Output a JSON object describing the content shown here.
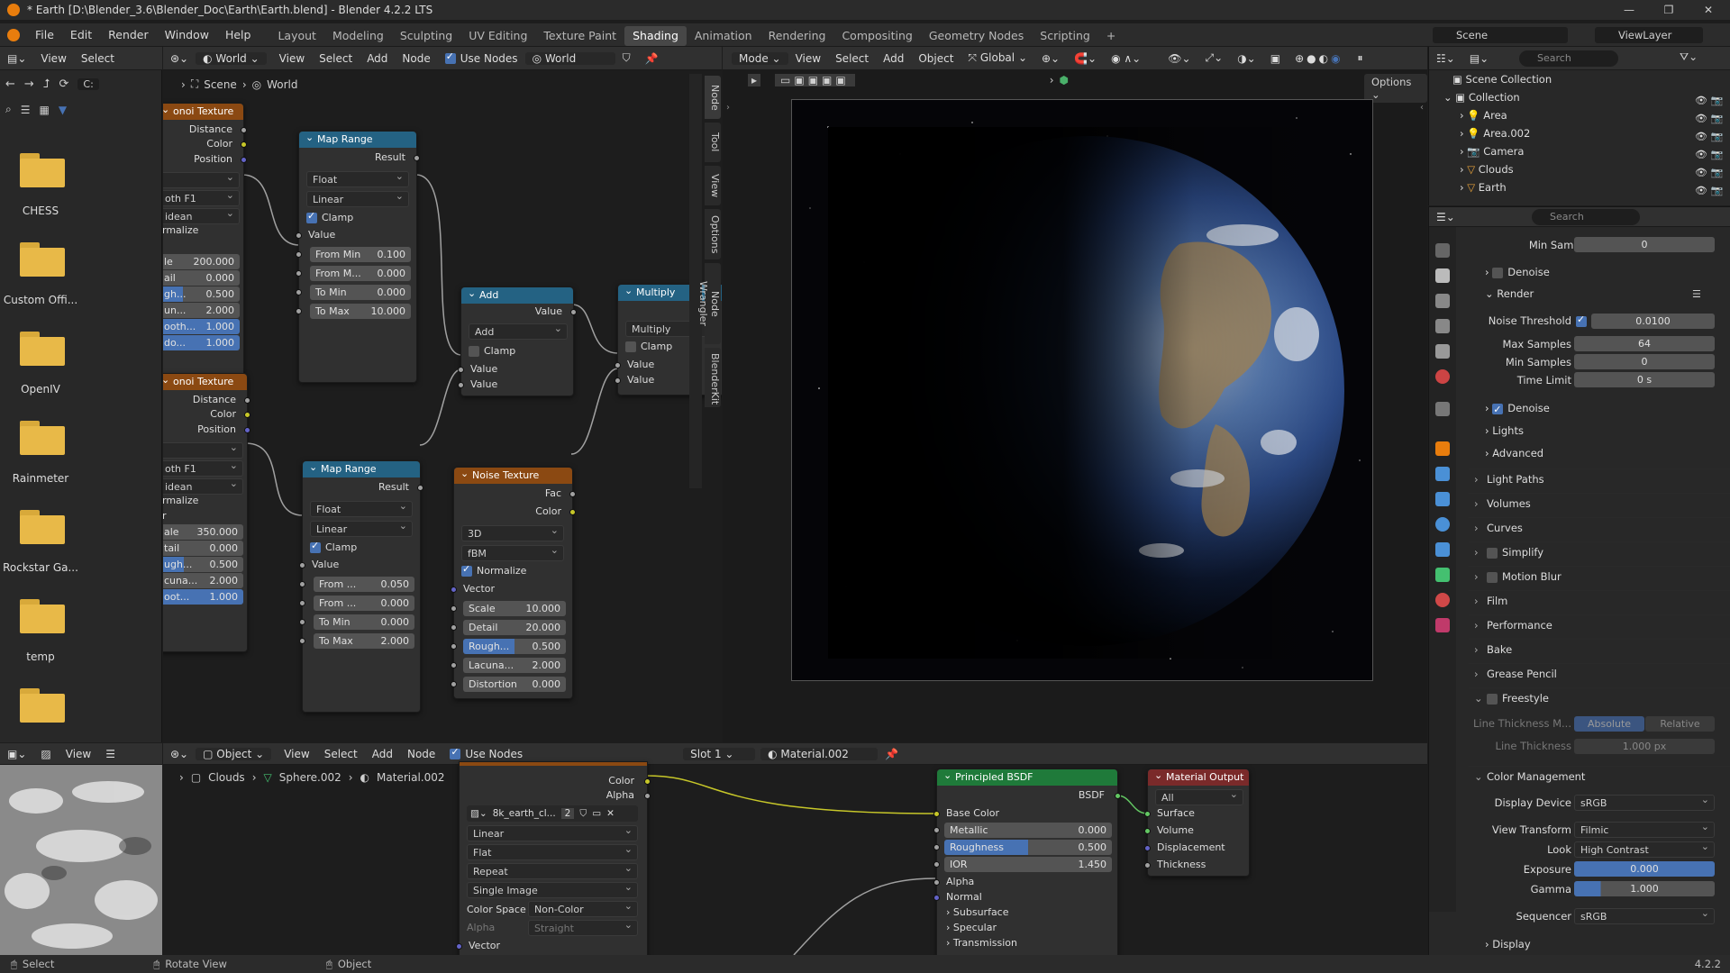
{
  "window": {
    "title": "* Earth [D:\\Blender_3.6\\Blender_Doc\\Earth\\Earth.blend] - Blender 4.2.2 LTS"
  },
  "menus": [
    "File",
    "Edit",
    "Render",
    "Window",
    "Help"
  ],
  "workspaces": [
    "Layout",
    "Modeling",
    "Sculpting",
    "UV Editing",
    "Texture Paint",
    "Shading",
    "Animation",
    "Rendering",
    "Compositing",
    "Geometry Nodes",
    "Scripting"
  ],
  "active_workspace": "Shading",
  "scene": {
    "name": "Scene",
    "view_layer": "ViewLayer"
  },
  "file_browser": {
    "path_text": "C:",
    "folders": [
      "CHESS",
      "Custom Offi...",
      "OpenIV",
      "Rainmeter",
      "Rockstar Ga...",
      "temp",
      ""
    ]
  },
  "node_editor_top": {
    "header": {
      "type": "World",
      "view": "View",
      "select": "Select",
      "add": "Add",
      "node": "Node",
      "use_nodes": "Use Nodes",
      "world_name": "World"
    },
    "breadcrumb": [
      "Scene",
      "World"
    ],
    "side_tabs": [
      "Node",
      "Tool",
      "View",
      "Options",
      "Node Wrangler",
      "BlenderKit"
    ],
    "nodes": {
      "voronoi1": {
        "title": "onoi Texture",
        "outputs": [
          "Distance",
          "Color",
          "Position"
        ],
        "dd1": "",
        "dd2": "oth F1",
        "dd3": "idean",
        "normalize": "rmalize",
        "fields": [
          [
            "le",
            "200.000"
          ],
          [
            "ail",
            "0.000"
          ],
          [
            "gh...",
            "0.500"
          ],
          [
            "un...",
            "2.000"
          ],
          [
            "ooth...",
            "1.000"
          ],
          [
            "do...",
            "1.000"
          ]
        ]
      },
      "voronoi2": {
        "title": "onoi Texture",
        "outputs": [
          "Distance",
          "Color",
          "Position"
        ],
        "dd1": "",
        "dd2": "oth F1",
        "dd3": "idean",
        "normalize": "rmalize",
        "r": "r",
        "fields": [
          [
            "ale",
            "350.000"
          ],
          [
            "tail",
            "0.000"
          ],
          [
            "ugh...",
            "0.500"
          ],
          [
            "cuna...",
            "2.000"
          ],
          [
            "oot...",
            "1.000"
          ]
        ]
      },
      "maprange1": {
        "title": "Map Range",
        "result": "Result",
        "dtype": "Float",
        "interp": "Linear",
        "clamp": "Clamp",
        "value": "Value",
        "fields": [
          [
            "From Min",
            "0.100"
          ],
          [
            "From M...",
            "0.000"
          ],
          [
            "To Min",
            "0.000"
          ],
          [
            "To Max",
            "10.000"
          ]
        ]
      },
      "maprange2": {
        "title": "Map Range",
        "result": "Result",
        "dtype": "Float",
        "interp": "Linear",
        "clamp": "Clamp",
        "value": "Value",
        "fields": [
          [
            "From ...",
            "0.050"
          ],
          [
            "From ...",
            "0.000"
          ],
          [
            "To Min",
            "0.000"
          ],
          [
            "To Max",
            "2.000"
          ]
        ]
      },
      "add": {
        "title": "Add",
        "value": "Value",
        "op": "Add",
        "clamp": "Clamp",
        "in1": "Value",
        "in2": "Value"
      },
      "multiply": {
        "title": "Multiply",
        "value": "Value",
        "op": "Multiply",
        "clamp": "Clamp",
        "in1": "Value",
        "in2": "Value"
      },
      "noise": {
        "title": "Noise Texture",
        "fac": "Fac",
        "color": "Color",
        "dims": "3D",
        "ntype": "fBM",
        "normalize": "Normalize",
        "vector": "Vector",
        "fields": [
          [
            "Scale",
            "10.000"
          ],
          [
            "Detail",
            "20.000"
          ],
          [
            "Rough...",
            "0.500"
          ],
          [
            "Lacuna...",
            "2.000"
          ],
          [
            "Distortion",
            "0.000"
          ]
        ]
      }
    }
  },
  "viewport": {
    "mode": "Mode",
    "view": "View",
    "select": "Select",
    "add": "Add",
    "object": "Object",
    "orientation": "Global",
    "options": "Options"
  },
  "outliner": {
    "search": "Search",
    "root": "Scene Collection",
    "collection": "Collection",
    "items": [
      "Area",
      "Area.002",
      "Camera",
      "Clouds",
      "Earth"
    ]
  },
  "properties": {
    "search": "Search",
    "top_rows": [
      [
        "Min Samples",
        "0"
      ]
    ],
    "denoise_top": "Denoise",
    "render_label": "Render",
    "render_rows": [
      [
        "Noise Threshold",
        "0.0100"
      ],
      [
        "Max Samples",
        "64"
      ],
      [
        "Min Samples",
        "0"
      ],
      [
        "Time Limit",
        "0 s"
      ]
    ],
    "sub_panels": [
      "Denoise",
      "Lights",
      "Advanced"
    ],
    "panels": [
      "Light Paths",
      "Volumes",
      "Curves",
      "Simplify",
      "Motion Blur",
      "Film",
      "Performance",
      "Bake",
      "Grease Pencil",
      "Freestyle"
    ],
    "line_thickness_mode": "Line Thickness M...",
    "absolute": "Absolute",
    "relative": "Relative",
    "line_thickness": "Line Thickness",
    "line_thickness_val": "1.000 px",
    "color_management": "Color Management",
    "cm_rows": [
      [
        "Display Device",
        "sRGB"
      ],
      [
        "View Transform",
        "Filmic"
      ],
      [
        "Look",
        "High Contrast"
      ],
      [
        "Exposure",
        "0.000"
      ],
      [
        "Gamma",
        "1.000"
      ],
      [
        "Sequencer",
        "sRGB"
      ]
    ],
    "display": "Display"
  },
  "node_editor_bottom": {
    "header": {
      "view": "View",
      "select": "Select",
      "add": "Add",
      "node": "Node",
      "use_nodes": "Use Nodes",
      "object": "Object",
      "slot": "Slot 1",
      "material": "Material.002",
      "image_view": "View"
    },
    "breadcrumb": [
      "Clouds",
      "Sphere.002",
      "Material.002"
    ],
    "image_node": {
      "color": "Color",
      "alpha": "Alpha",
      "image": "8k_earth_cl...",
      "users": "2",
      "interp": "Linear",
      "proj": "Flat",
      "ext": "Repeat",
      "src": "Single Image",
      "cs_label": "Color Space",
      "cs": "Non-Color",
      "alpha_label": "Alpha",
      "alpha_mode": "Straight",
      "vector": "Vector"
    },
    "bsdf": {
      "title": "Principled BSDF",
      "out": "BSDF",
      "base_color": "Base Color",
      "rows": [
        [
          "Metallic",
          "0.000"
        ],
        [
          "Roughness",
          "0.500"
        ],
        [
          "IOR",
          "1.450"
        ]
      ],
      "alpha": "Alpha",
      "normal": "Normal",
      "subs": [
        "Subsurface",
        "Specular",
        "Transmission"
      ]
    },
    "output": {
      "title": "Material Output",
      "target": "All",
      "inputs": [
        "Surface",
        "Volume",
        "Displacement",
        "Thickness"
      ]
    }
  },
  "status": {
    "select": "Select",
    "rotate": "Rotate View",
    "object": "Object",
    "version": "4.2.2"
  },
  "colors": {
    "accent": "#4772b3",
    "conv_header": "#246283",
    "tex_header": "#8b4912",
    "shader_header": "#1f7a3a",
    "output_header": "#7a2a2a"
  }
}
